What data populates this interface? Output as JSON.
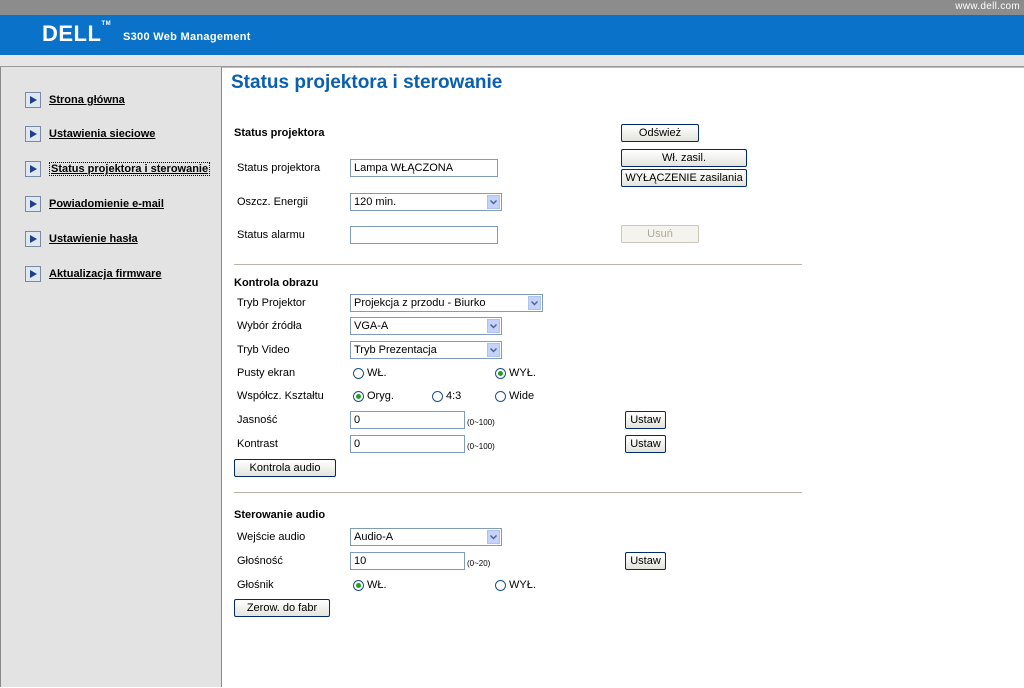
{
  "top_bar": {
    "url": "www.dell.com"
  },
  "header": {
    "logo": "DELL",
    "product": "S300 Web Management"
  },
  "sidebar": {
    "items": [
      {
        "label": "Strona główna"
      },
      {
        "label": "Ustawienia sieciowe"
      },
      {
        "label": "Status projektora i sterowanie"
      },
      {
        "label": "Powiadomienie e-mail"
      },
      {
        "label": "Ustawienie hasła"
      },
      {
        "label": "Aktualizacja firmware"
      }
    ]
  },
  "page": {
    "title": "Status projektora i sterowanie"
  },
  "projector_status": {
    "heading": "Status projektora",
    "refresh_button": "Odśwież",
    "status_label": "Status projektora",
    "status_value": "Lampa WŁĄCZONA",
    "power_on_button": "Wł. zasil.",
    "power_off_button": "WYŁĄCZENIE zasilania",
    "energy_label": "Oszcz. Energii",
    "energy_value": "120 min.",
    "alarm_label": "Status alarmu",
    "alarm_value": "",
    "delete_button": "Usuń"
  },
  "image_control": {
    "heading": "Kontrola obrazu",
    "projector_mode_label": "Tryb Projektor",
    "projector_mode_value": "Projekcja z przodu - Biurko",
    "source_label": "Wybór źródła",
    "source_value": "VGA-A",
    "video_mode_label": "Tryb Video",
    "video_mode_value": "Tryb Prezentacja",
    "blank_label": "Pusty ekran",
    "blank_on": "WŁ.",
    "blank_off": "WYŁ.",
    "blank_selected": "off",
    "aspect_label": "Współcz. Kształtu",
    "aspect_original": "Oryg.",
    "aspect_43": "4:3",
    "aspect_wide": "Wide",
    "aspect_selected": "original",
    "brightness_label": "Jasność",
    "brightness_value": "0",
    "brightness_range": "(0~100)",
    "contrast_label": "Kontrast",
    "contrast_value": "0",
    "contrast_range": "(0~100)",
    "set_button": "Ustaw",
    "audio_control_button": "Kontrola audio"
  },
  "audio_control": {
    "heading": "Sterowanie audio",
    "input_label": "Wejście audio",
    "input_value": "Audio-A",
    "volume_label": "Głośność",
    "volume_value": "10",
    "volume_range": "(0~20)",
    "set_button": "Ustaw",
    "speaker_label": "Głośnik",
    "speaker_on": "WŁ.",
    "speaker_off": "WYŁ.",
    "speaker_selected": "on",
    "reset_button": "Zerow. do fabr"
  },
  "colors": {
    "header_blue": "#0a72c8",
    "title_blue": "#0a60b0",
    "sidebar_gray": "#e3e3e3"
  }
}
